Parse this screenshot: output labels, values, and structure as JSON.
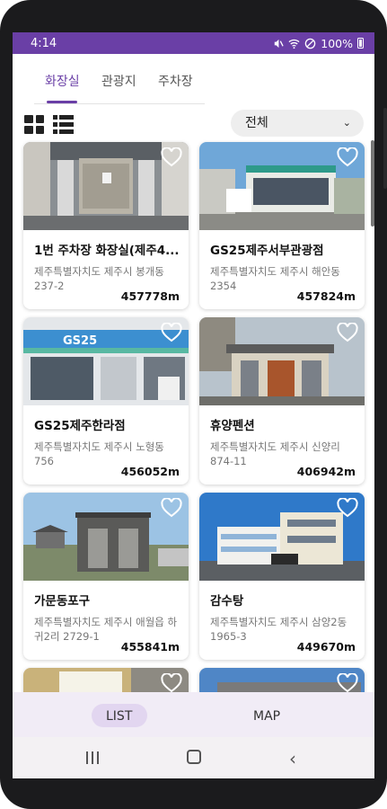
{
  "status_bar": {
    "time": "4:14",
    "battery": "100%"
  },
  "tabs": [
    {
      "label": "화장실",
      "active": true
    },
    {
      "label": "관광지",
      "active": false
    },
    {
      "label": "주차장",
      "active": false
    }
  ],
  "filter": {
    "selected": "전체"
  },
  "cards": [
    {
      "title": "1번 주차장 화장실(제주4...",
      "address": "제주특별자치도 제주시 봉개동 237-2",
      "distance": "457778m",
      "image": "restroom-building-photo"
    },
    {
      "title": "GS25제주서부관광점",
      "address": "제주특별자치도 제주시 해안동 2354",
      "distance": "457824m",
      "image": "convenience-store-photo"
    },
    {
      "title": "GS25제주한라점",
      "address": "제주특별자치도 제주시 노형동 756",
      "distance": "456052m",
      "image": "convenience-store-photo"
    },
    {
      "title": "휴양펜션",
      "address": "제주특별자치도 제주시 신양리 874-11",
      "distance": "406942m",
      "image": "small-building-photo"
    },
    {
      "title": "가문동포구",
      "address": "제주특별자치도 제주시 애월읍 하귀2리 2729-1",
      "distance": "455841m",
      "image": "harbor-restroom-photo"
    },
    {
      "title": "감수탕",
      "address": "제주특별자치도 제주시 삼양2동 1965-3",
      "distance": "449670m",
      "image": "white-building-photo"
    },
    {
      "title": "",
      "address": "",
      "distance": "",
      "image": "partial-photo"
    },
    {
      "title": "",
      "address": "",
      "distance": "",
      "image": "partial-photo"
    }
  ],
  "bottom_nav": {
    "list_label": "LIST",
    "map_label": "MAP",
    "active": "LIST"
  },
  "colors": {
    "accent": "#6a3fa6",
    "nav_bg": "#f1ecf6",
    "pill": "#e2d6f0"
  }
}
